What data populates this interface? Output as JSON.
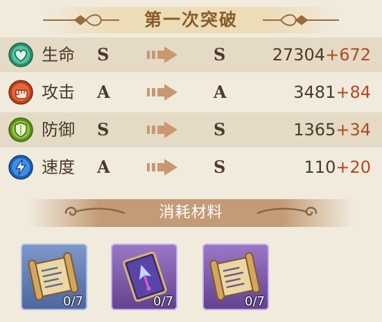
{
  "title": "第一次突破",
  "stats": [
    {
      "label": "生命",
      "icon": "heart-icon",
      "color": "#3fb08e",
      "old_rank": "S",
      "new_rank": "S",
      "base": "27304",
      "bonus": "+672"
    },
    {
      "label": "攻击",
      "icon": "fist-icon",
      "color": "#d9542b",
      "old_rank": "A",
      "new_rank": "A",
      "base": "3481",
      "bonus": "+84"
    },
    {
      "label": "防御",
      "icon": "shield-icon",
      "color": "#78b02c",
      "old_rank": "S",
      "new_rank": "S",
      "base": "1365",
      "bonus": "+34"
    },
    {
      "label": "速度",
      "icon": "lightning-icon",
      "color": "#2f7fd6",
      "old_rank": "A",
      "new_rank": "S",
      "base": "110",
      "bonus": "+20"
    }
  ],
  "materials_header": "消耗材料",
  "materials": [
    {
      "icon": "scroll-icon",
      "rarity": "blue",
      "count": "0/7"
    },
    {
      "icon": "book-icon",
      "rarity": "purple",
      "count": "0/7"
    },
    {
      "icon": "scroll-icon",
      "rarity": "purple",
      "count": "0/7"
    }
  ]
}
